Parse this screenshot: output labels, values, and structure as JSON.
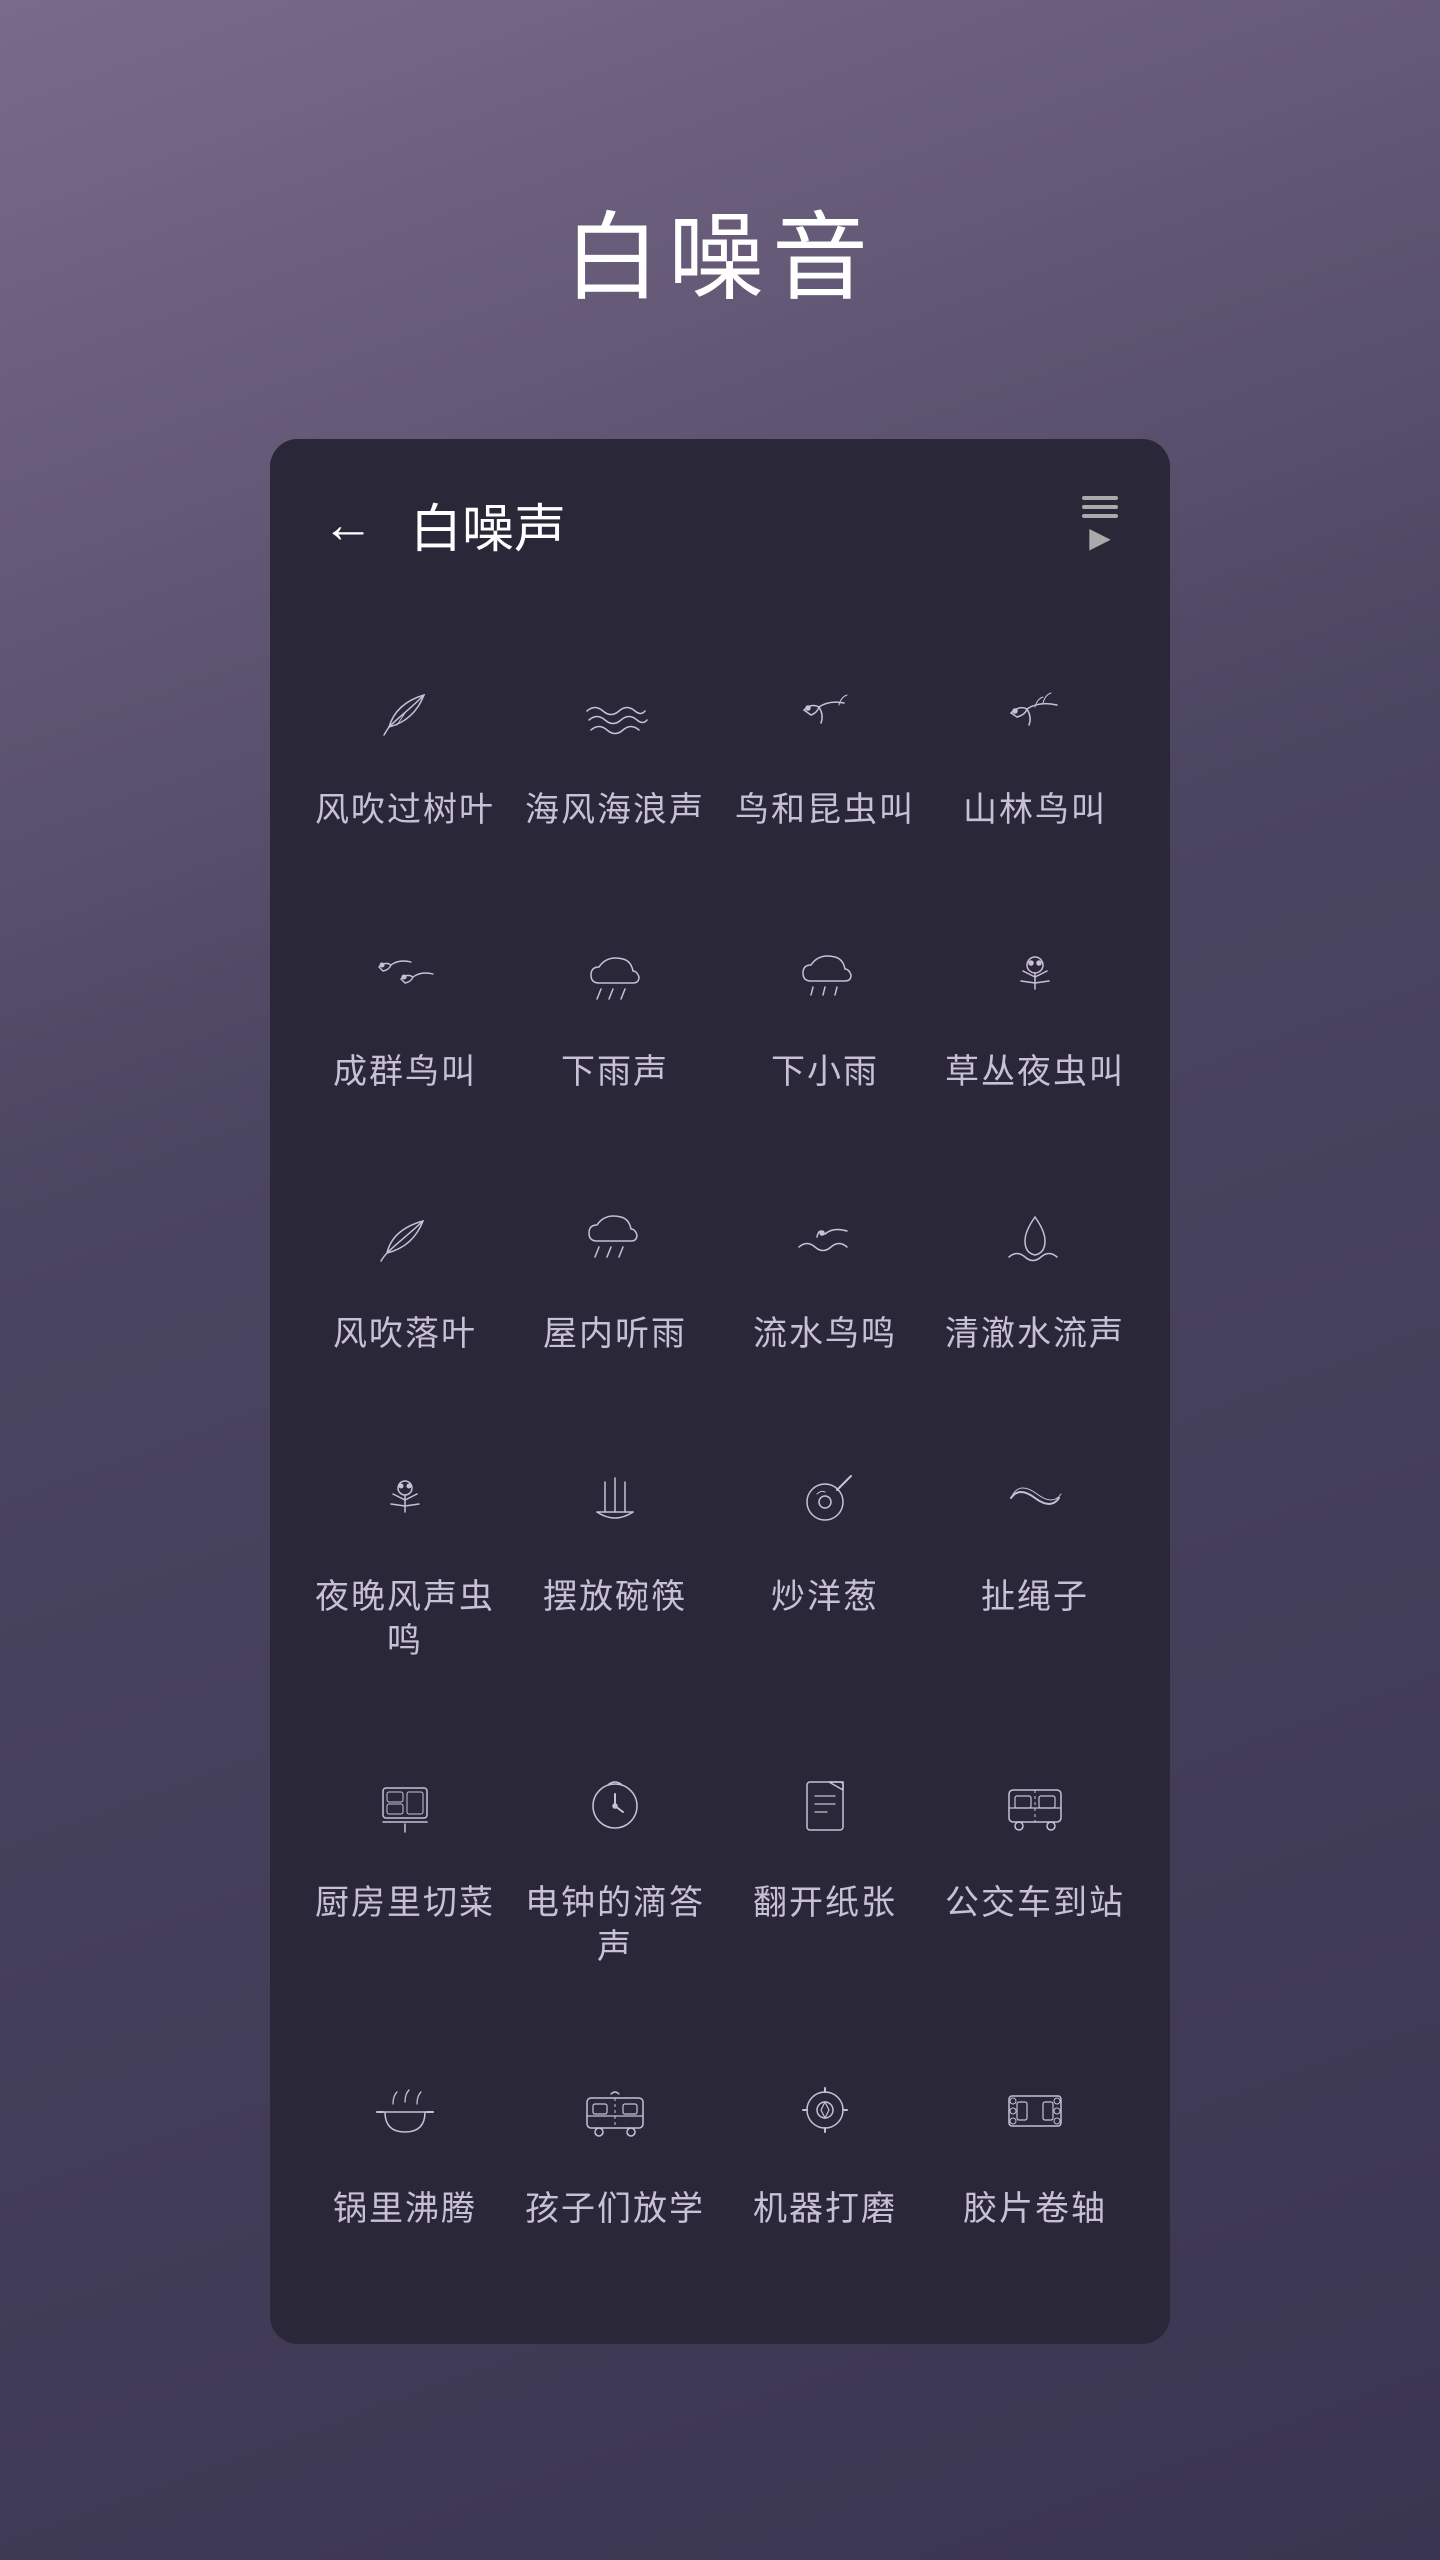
{
  "page": {
    "title": "白噪音",
    "card_title": "白噪声"
  },
  "header": {
    "back_label": "←",
    "title": "白噪声"
  },
  "items": [
    {
      "id": "wind-leaves",
      "label": "风吹过树叶",
      "icon": "wind-leaf"
    },
    {
      "id": "sea-waves",
      "label": "海风海浪声",
      "icon": "sea-waves"
    },
    {
      "id": "bird-insects",
      "label": "鸟和昆虫叫",
      "icon": "bird"
    },
    {
      "id": "forest-birds",
      "label": "山林鸟叫",
      "icon": "bird2"
    },
    {
      "id": "flock-birds",
      "label": "成群鸟叫",
      "icon": "flock-bird"
    },
    {
      "id": "rain",
      "label": "下雨声",
      "icon": "rain"
    },
    {
      "id": "light-rain",
      "label": "下小雨",
      "icon": "rain2"
    },
    {
      "id": "night-insects",
      "label": "草丛夜虫叫",
      "icon": "insects"
    },
    {
      "id": "wind-fall-leaves",
      "label": "风吹落叶",
      "icon": "wind-leaf2"
    },
    {
      "id": "indoor-rain",
      "label": "屋内听雨",
      "icon": "rain3"
    },
    {
      "id": "stream-birds",
      "label": "流水鸟鸣",
      "icon": "water-bird"
    },
    {
      "id": "clear-water",
      "label": "清澈水流声",
      "icon": "water"
    },
    {
      "id": "night-wind-insects",
      "label": "夜晚风声虫鸣",
      "icon": "insects2"
    },
    {
      "id": "bowls",
      "label": "摆放碗筷",
      "icon": "bowls"
    },
    {
      "id": "fry-onion",
      "label": "炒洋葱",
      "icon": "fry"
    },
    {
      "id": "rope",
      "label": "扯绳子",
      "icon": "rope"
    },
    {
      "id": "kitchen-chop",
      "label": "厨房里切菜",
      "icon": "kitchen"
    },
    {
      "id": "clock",
      "label": "电钟的滴答声",
      "icon": "clock"
    },
    {
      "id": "paper",
      "label": "翻开纸张",
      "icon": "paper"
    },
    {
      "id": "bus",
      "label": "公交车到站",
      "icon": "bus"
    },
    {
      "id": "pot-boil",
      "label": "锅里沸腾",
      "icon": "pot"
    },
    {
      "id": "school-out",
      "label": "孩子们放学",
      "icon": "school-bus"
    },
    {
      "id": "machine-grind",
      "label": "机器打磨",
      "icon": "machine"
    },
    {
      "id": "film-reel",
      "label": "胶片卷轴",
      "icon": "film"
    }
  ]
}
